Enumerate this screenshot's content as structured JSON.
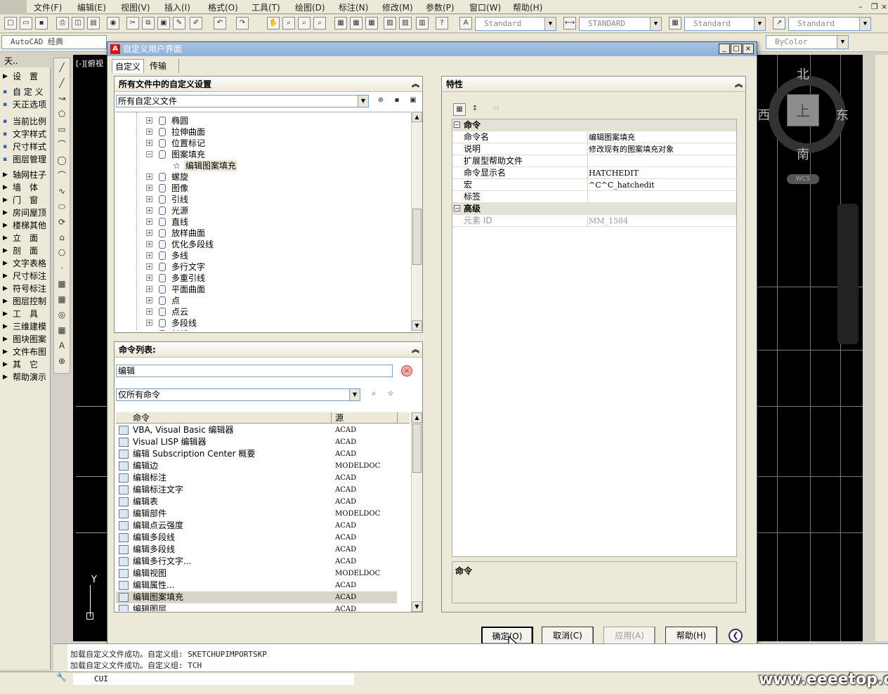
{
  "app": {
    "menu": [
      "文件(F)",
      "编辑(E)",
      "视图(V)",
      "插入(I)",
      "格式(O)",
      "工具(T)",
      "绘图(D)",
      "标注(N)",
      "修改(M)",
      "参数(P)",
      "窗口(W)",
      "帮助(H)"
    ],
    "toolbar_combos": [
      "Standard",
      "STANDARD",
      "Standard",
      "Standard"
    ],
    "workspace_combo": "AutoCAD 经典",
    "color_combo": "ByColor",
    "view_label": "[-][俯视"
  },
  "left_panel": {
    "header": "天..",
    "items": [
      {
        "label": "设　置",
        "tri": true
      },
      {
        "label": "自 定 义",
        "tri": false
      },
      {
        "label": "天正选项",
        "tri": false
      },
      {
        "label": "当前比例",
        "tri": false
      },
      {
        "label": "文字样式",
        "tri": false
      },
      {
        "label": "尺寸样式",
        "tri": false
      },
      {
        "label": "图层管理",
        "tri": false
      },
      {
        "label": "轴网柱子",
        "tri": true
      },
      {
        "label": "墙　体",
        "tri": true
      },
      {
        "label": "门　窗",
        "tri": true
      },
      {
        "label": "房间屋顶",
        "tri": true
      },
      {
        "label": "楼梯其他",
        "tri": true
      },
      {
        "label": "立　面",
        "tri": true
      },
      {
        "label": "剖　面",
        "tri": true
      },
      {
        "label": "文字表格",
        "tri": true
      },
      {
        "label": "尺寸标注",
        "tri": true
      },
      {
        "label": "符号标注",
        "tri": true
      },
      {
        "label": "图层控制",
        "tri": true
      },
      {
        "label": "工　具",
        "tri": true
      },
      {
        "label": "三维建模",
        "tri": true
      },
      {
        "label": "图块图案",
        "tri": true
      },
      {
        "label": "文件布图",
        "tri": true
      },
      {
        "label": "其　它",
        "tri": true
      },
      {
        "label": "帮助演示",
        "tri": true
      }
    ]
  },
  "dialog": {
    "title": "自定义用户界面",
    "tabs": [
      "自定义",
      "传输"
    ],
    "customizations": {
      "header": "所有文件中的自定义设置",
      "filter": "所有自定义文件",
      "tree": [
        {
          "label": "椭圆",
          "pm": "+"
        },
        {
          "label": "拉伸曲面",
          "pm": "+"
        },
        {
          "label": "位置标记",
          "pm": "+"
        },
        {
          "label": "图案填充",
          "pm": "−"
        },
        {
          "label": "编辑图案填充",
          "child": true
        },
        {
          "label": "螺旋",
          "pm": "+"
        },
        {
          "label": "图像",
          "pm": "+"
        },
        {
          "label": "引线",
          "pm": "+"
        },
        {
          "label": "光源",
          "pm": "+"
        },
        {
          "label": "直线",
          "pm": "+"
        },
        {
          "label": "放样曲面",
          "pm": "+"
        },
        {
          "label": "优化多段线",
          "pm": "+"
        },
        {
          "label": "多线",
          "pm": "+"
        },
        {
          "label": "多行文字",
          "pm": "+"
        },
        {
          "label": "多重引线",
          "pm": "+"
        },
        {
          "label": "平面曲面",
          "pm": "+"
        },
        {
          "label": "点",
          "pm": "+"
        },
        {
          "label": "点云",
          "pm": "+"
        },
        {
          "label": "多段线",
          "pm": "+"
        },
        {
          "label": "射线",
          "pm": "+"
        }
      ]
    },
    "command_list": {
      "header": "命令列表:",
      "search": "编辑",
      "filter": "仅所有命令",
      "col_command": "命令",
      "col_source": "源",
      "rows": [
        {
          "name": "VBA, Visual Basic 编辑器",
          "src": "ACAD"
        },
        {
          "name": "Visual LISP 编辑器",
          "src": "ACAD"
        },
        {
          "name": "编辑 Subscription Center 概要",
          "src": "ACAD"
        },
        {
          "name": "编辑边",
          "src": "MODELDOC"
        },
        {
          "name": "编辑标注",
          "src": "ACAD"
        },
        {
          "name": "编辑标注文字",
          "src": "ACAD"
        },
        {
          "name": "编辑表",
          "src": "ACAD"
        },
        {
          "name": "编辑部件",
          "src": "MODELDOC"
        },
        {
          "name": "编辑点云强度",
          "src": "ACAD"
        },
        {
          "name": "编辑多段线",
          "src": "ACAD"
        },
        {
          "name": "编辑多段线",
          "src": "ACAD"
        },
        {
          "name": "编辑多行文字...",
          "src": "ACAD"
        },
        {
          "name": "编辑视图",
          "src": "MODELDOC"
        },
        {
          "name": "编辑属性...",
          "src": "ACAD"
        },
        {
          "name": "编辑图案填充",
          "src": "ACAD",
          "selected": true
        },
        {
          "name": "编辑图层",
          "src": "ACAD"
        }
      ]
    },
    "properties": {
      "header": "特性",
      "group_command": "命令",
      "group_advanced": "高级",
      "rows": [
        {
          "k": "命令名",
          "v": "编辑图案填充"
        },
        {
          "k": "说明",
          "v": "修改现有的图案填充对象"
        },
        {
          "k": "扩展型帮助文件",
          "v": ""
        },
        {
          "k": "命令显示名",
          "v": "HATCHEDIT"
        },
        {
          "k": "宏",
          "v": "^C^C_hatchedit"
        },
        {
          "k": "标签",
          "v": ""
        }
      ],
      "adv_rows": [
        {
          "k": "元素 ID",
          "v": "MM_1584"
        }
      ],
      "desc_title": "命令"
    },
    "buttons": {
      "ok": "确定(O)",
      "cancel": "取消(C)",
      "apply": "应用(A)",
      "help": "帮助(H)"
    }
  },
  "compass": {
    "n": "北",
    "s": "南",
    "w": "西",
    "e": "东",
    "top": "上",
    "wcs": "WCS"
  },
  "command_line": {
    "line1": "加载自定义文件成功。自定义组: SKETCHUPIMPORTSKP",
    "line2": "加载自定义文件成功。自定义组: TCH",
    "prompt": "CUI"
  },
  "watermark": "www.eeeetop.com"
}
